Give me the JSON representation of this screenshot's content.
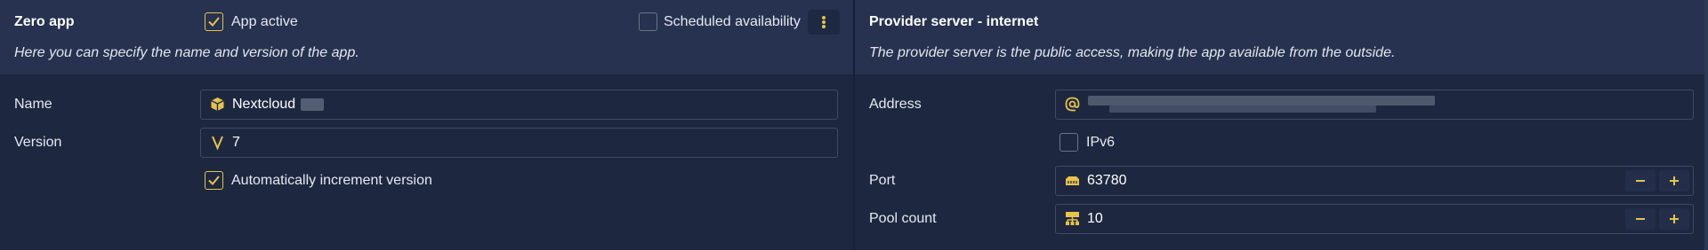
{
  "zero_app": {
    "title": "Zero app",
    "description": "Here you can specify the name and version of the app.",
    "app_active": {
      "label": "App active",
      "checked": true
    },
    "scheduled": {
      "label": "Scheduled availability",
      "checked": false
    },
    "name": {
      "label": "Name",
      "value": "Nextcloud"
    },
    "version": {
      "label": "Version",
      "value": "7"
    },
    "auto_increment": {
      "label": "Automatically increment version",
      "checked": true
    }
  },
  "provider": {
    "title": "Provider server - internet",
    "description": "The provider server is the public access, making the app available from the outside.",
    "address": {
      "label": "Address",
      "value": ""
    },
    "ipv6": {
      "label": "IPv6",
      "checked": false
    },
    "port": {
      "label": "Port",
      "value": "63780"
    },
    "pool_count": {
      "label": "Pool count",
      "value": "10"
    }
  },
  "colors": {
    "accent": "#e8c24a",
    "panel_bg": "#1d2840",
    "header_bg": "#26324f",
    "border": "#3e4a64"
  },
  "icons": [
    "checkbox-checked-icon",
    "kebab-menu-icon",
    "cube-icon",
    "version-v-icon",
    "at-icon",
    "ethernet-port-icon",
    "pool-network-icon",
    "minus-icon",
    "plus-icon"
  ]
}
